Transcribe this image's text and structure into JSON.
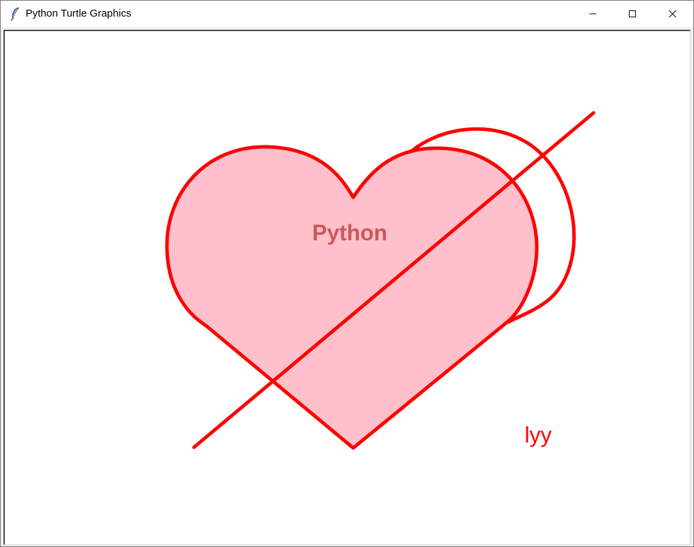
{
  "window": {
    "title": "Python Turtle Graphics",
    "icon": "feather-icon",
    "controls": {
      "minimize": "minimize-icon",
      "maximize": "maximize-icon",
      "close": "close-icon"
    }
  },
  "canvas": {
    "heart_center_text": "Python",
    "signature_text": "lyy",
    "colors": {
      "heart_fill": "#ffc0cb",
      "stroke": "#ff0000",
      "center_text": "#c85a5a",
      "signature": "#ff0000",
      "background": "#ffffff"
    }
  }
}
